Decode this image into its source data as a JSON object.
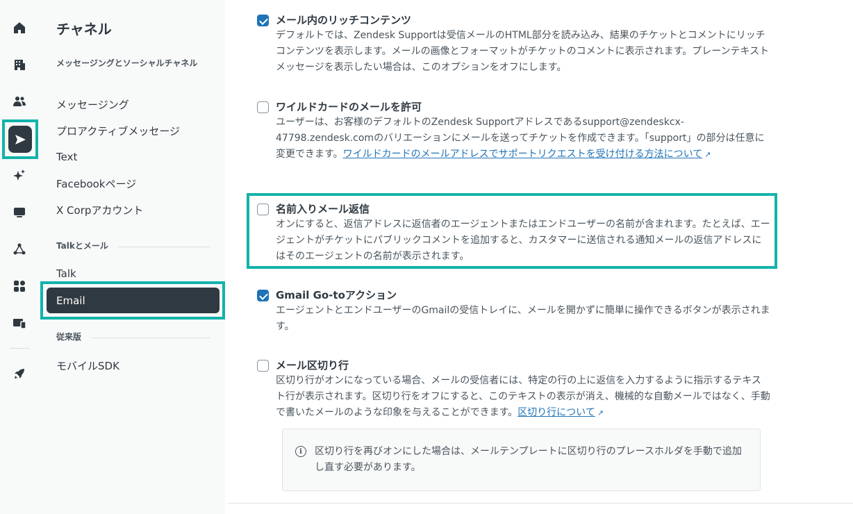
{
  "rail": {
    "items": [
      {
        "icon": "home-icon"
      },
      {
        "icon": "building-icon"
      },
      {
        "icon": "users-icon"
      },
      {
        "icon": "channels-icon",
        "active": true
      },
      {
        "icon": "sparkle-icon"
      },
      {
        "icon": "workspace-icon"
      },
      {
        "icon": "objects-icon"
      },
      {
        "icon": "apps-icon"
      },
      {
        "icon": "devices-icon"
      },
      {
        "icon": "rocket-icon"
      }
    ]
  },
  "nav": {
    "title": "チャネル",
    "section1": "メッセージングとソーシャルチャネル",
    "items1": [
      "メッセージング",
      "プロアクティブメッセージ",
      "Text",
      "Facebookページ",
      "X Corpアカウント"
    ],
    "section2": "Talkとメール",
    "items2": [
      "Talk",
      "Email"
    ],
    "section3": "従来版",
    "items3": [
      "モバイルSDK"
    ]
  },
  "options": [
    {
      "title": "メール内のリッチコンテンツ",
      "checked": true,
      "desc": "デフォルトでは、Zendesk Supportは受信メールのHTML部分を読み込み、結果のチケットとコメントにリッチコンテンツを表示します。メールの画像とフォーマットがチケットのコメントに表示されます。プレーンテキストメッセージを表示したい場合は、このオプションをオフにします。"
    },
    {
      "title": "ワイルドカードのメールを許可",
      "checked": false,
      "desc": "ユーザーは、お客様のデフォルトのZendesk Supportアドレスであるsupport@zendeskcx-47798.zendesk.comのバリエーションにメールを送ってチケットを作成できます。「support」の部分は任意に変更できます。",
      "link": "ワイルドカードのメールアドレスでサポートリクエストを受け付ける方法について"
    },
    {
      "title": "名前入りメール返信",
      "checked": false,
      "desc": "オンにすると、返信アドレスに返信者のエージェントまたはエンドユーザーの名前が含まれます。たとえば、エージェントがチケットにパブリックコメントを追加すると、カスタマーに送信される通知メールの返信アドレスにはそのエージェントの名前が表示されます。"
    },
    {
      "title": "Gmail Go-toアクション",
      "checked": true,
      "desc": "エージェントとエンドユーザーのGmailの受信トレイに、メールを開かずに簡単に操作できるボタンが表示されます。"
    },
    {
      "title": "メール区切り行",
      "checked": false,
      "desc": "区切り行がオンになっている場合、メールの受信者には、特定の行の上に返信を入力するように指示するテキスト行が表示されます。区切り行をオフにすると、このテキストの表示が消え、機械的な自動メールではなく、手動で書いたメールのような印象を与えることができます。",
      "link": "区切り行について"
    }
  ],
  "info": {
    "icon": "info-icon",
    "text": "区切り行を再びオンにした場合は、メールテンプレートに区切り行のプレースホルダを手動で追加し直す必要があります。"
  },
  "colors": {
    "accent_highlight": "#12b3aa",
    "checkbox_checked": "#1f73b7",
    "nav_active_bg": "#2f3941",
    "link": "#1f73b7"
  }
}
